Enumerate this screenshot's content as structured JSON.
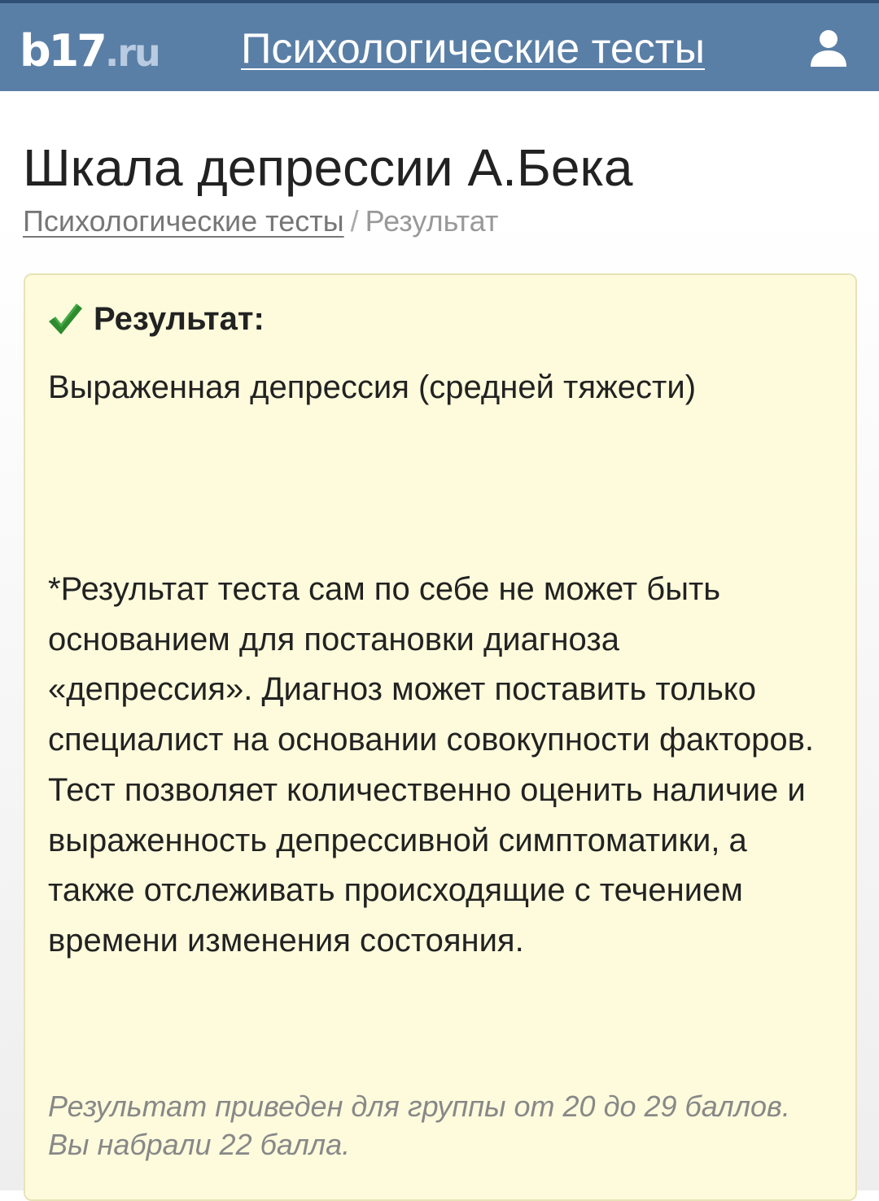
{
  "header": {
    "logo_main": "b17",
    "logo_suffix": ".ru",
    "site_title": "Психологические тесты",
    "user_icon": "user-icon"
  },
  "page": {
    "title": "Шкала депрессии А.Бека",
    "breadcrumb": {
      "link": "Психологические тесты",
      "separator": "/",
      "current": "Результат"
    }
  },
  "result": {
    "icon": "check-icon",
    "icon_color": "#2e8b2e",
    "label": "Результат:",
    "value": "Выраженная депрессия (средней тяжести)",
    "disclaimer_1": "*Результат теста сам по себе не может быть основанием для постановки диагноза «депрессия». Диагноз может поставить только специалист на основании совокупности факторов.",
    "disclaimer_2": "Тест позволяет количественно оценить наличие и выраженность депрессивной симптоматики, а также отслеживать происходящие с течением времени изменения состояния.",
    "score_note": "Результат приведен для группы от 20 до 29 баллов. Вы набрали 22 балла."
  },
  "colors": {
    "header_bg": "#5a7fa6",
    "result_bg": "#fdfbdc",
    "result_border": "#e8e3b8"
  }
}
